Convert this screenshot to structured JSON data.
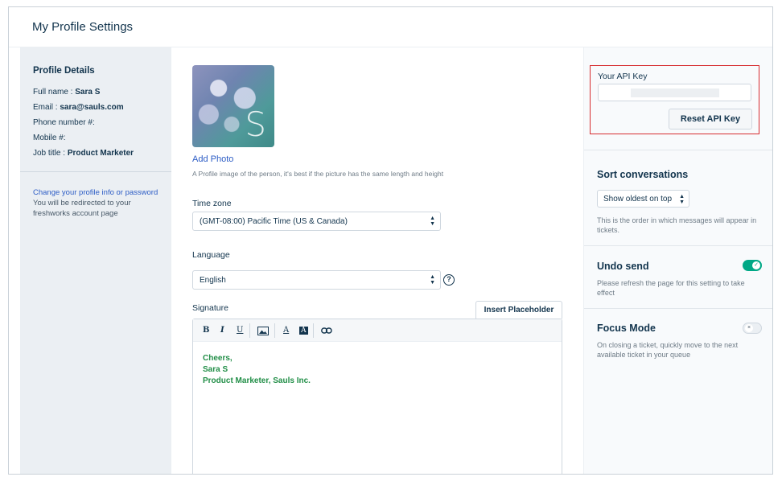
{
  "header": {
    "title": "My Profile Settings"
  },
  "profile_details": {
    "title": "Profile Details",
    "rows": [
      {
        "label": "Full name : ",
        "value": "Sara S"
      },
      {
        "label": "Email : ",
        "value": "sara@sauls.com"
      },
      {
        "label": "Phone number #:",
        "value": ""
      },
      {
        "label": "Mobile #:",
        "value": ""
      },
      {
        "label": "Job title : ",
        "value": "Product Marketer"
      }
    ],
    "note_link": "Change your profile info or password",
    "note_text": " You will be redirected to your freshworks account page"
  },
  "photo": {
    "avatar_letter": "S",
    "add_label": "Add Photo",
    "hint": "A Profile image of the person, it's best if the picture has the same length and height"
  },
  "timezone": {
    "label": "Time zone",
    "value": "(GMT-08:00) Pacific Time (US & Canada)"
  },
  "language": {
    "label": "Language",
    "value": "English"
  },
  "signature": {
    "label": "Signature",
    "insert_button": "Insert Placeholder",
    "toolbar": {
      "bold": "B",
      "italic": "I",
      "underline": "U",
      "font_color": "A",
      "bg_color": "A"
    },
    "lines": [
      "Cheers,",
      "Sara S",
      "Product Marketer, Sauls Inc."
    ]
  },
  "api": {
    "label": "Your API Key",
    "reset_button": "Reset API Key"
  },
  "sort": {
    "title": "Sort conversations",
    "selected": "Show oldest on top",
    "desc": "This is the order in which messages will appear in tickets."
  },
  "undo": {
    "title": "Undo send",
    "desc": "Please refresh the page for this setting to take effect",
    "enabled": true
  },
  "focus": {
    "title": "Focus Mode",
    "desc": "On closing a ticket, quickly move to the next available ticket in your queue",
    "enabled": false
  },
  "colors": {
    "accent_link": "#2c5cc5",
    "signature_green": "#218e47",
    "toggle_on": "#00a886",
    "highlight_red": "#d72d30"
  }
}
